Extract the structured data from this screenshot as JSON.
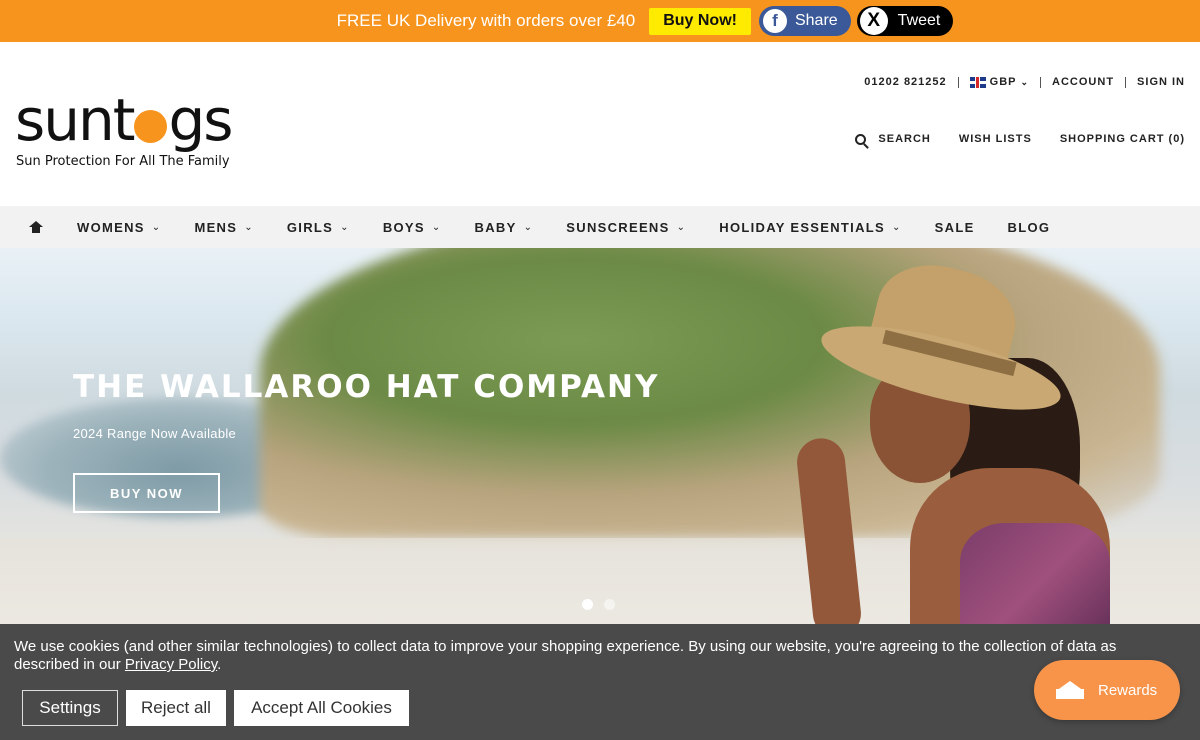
{
  "promo": {
    "text": "FREE UK Delivery with orders over £40",
    "buy_label": "Buy Now!",
    "share_label": "Share",
    "share_icon": "f",
    "tweet_label": "Tweet",
    "tweet_icon": "X"
  },
  "header": {
    "logo_pre": "suntogs",
    "logo_tagline": "Sun Protection For All The Family",
    "phone": "01202 821252",
    "currency": "GBP",
    "account": "ACCOUNT",
    "sign_in": "SIGN IN",
    "search": "SEARCH",
    "wish_lists": "WISH LISTS",
    "cart": "SHOPPING CART (0)"
  },
  "nav": {
    "items": [
      {
        "label": "WOMENS",
        "has_dropdown": true
      },
      {
        "label": "MENS",
        "has_dropdown": true
      },
      {
        "label": "GIRLS",
        "has_dropdown": true
      },
      {
        "label": "BOYS",
        "has_dropdown": true
      },
      {
        "label": "BABY",
        "has_dropdown": true
      },
      {
        "label": "SUNSCREENS",
        "has_dropdown": true
      },
      {
        "label": "HOLIDAY ESSENTIALS",
        "has_dropdown": true
      },
      {
        "label": "SALE",
        "has_dropdown": false
      },
      {
        "label": "BLOG",
        "has_dropdown": false
      }
    ]
  },
  "hero": {
    "title": "THE WALLAROO HAT COMPANY",
    "subtitle": "2024 Range Now Available",
    "button": "BUY NOW"
  },
  "cookie": {
    "text": "We use cookies (and other similar technologies) to collect data to improve your shopping experience. By using our website, you're agreeing to the collection of data as described in our",
    "link": "Privacy Policy",
    "suffix": ".",
    "settings": "Settings",
    "reject": "Reject all",
    "accept": "Accept All Cookies"
  },
  "rewards": {
    "label": "Rewards"
  },
  "colors": {
    "accent_orange": "#f7941d",
    "promo_yellow": "#ffeb00",
    "facebook": "#3b5998",
    "cookie_bg": "#4a4a4a"
  }
}
